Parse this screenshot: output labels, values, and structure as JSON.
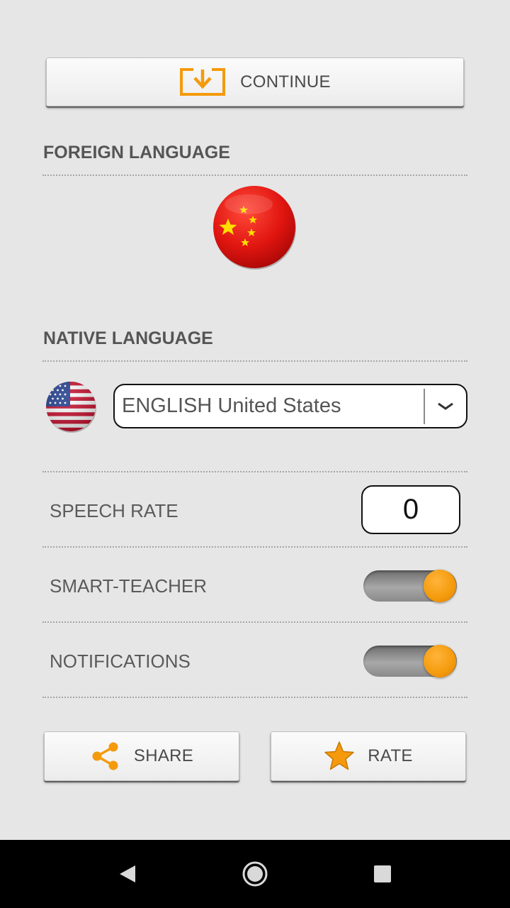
{
  "continue_button": {
    "label": "CONTINUE",
    "icon": "download-icon",
    "accent": "#f49a0c"
  },
  "foreign_language": {
    "title": "FOREIGN LANGUAGE",
    "flag": "china-flag-icon"
  },
  "native_language": {
    "title": "NATIVE LANGUAGE",
    "flag": "usa-flag-icon",
    "selected": "ENGLISH United States"
  },
  "settings": {
    "speech_rate": {
      "label": "SPEECH RATE",
      "value": "0"
    },
    "smart_teacher": {
      "label": "SMART-TEACHER",
      "enabled": true
    },
    "notifications": {
      "label": "NOTIFICATIONS",
      "enabled": true
    }
  },
  "actions": {
    "share_label": "SHARE",
    "rate_label": "RATE"
  },
  "colors": {
    "accent": "#f49a0c",
    "background": "#e6e6e6",
    "toggle_knob": "#f49a0c"
  }
}
